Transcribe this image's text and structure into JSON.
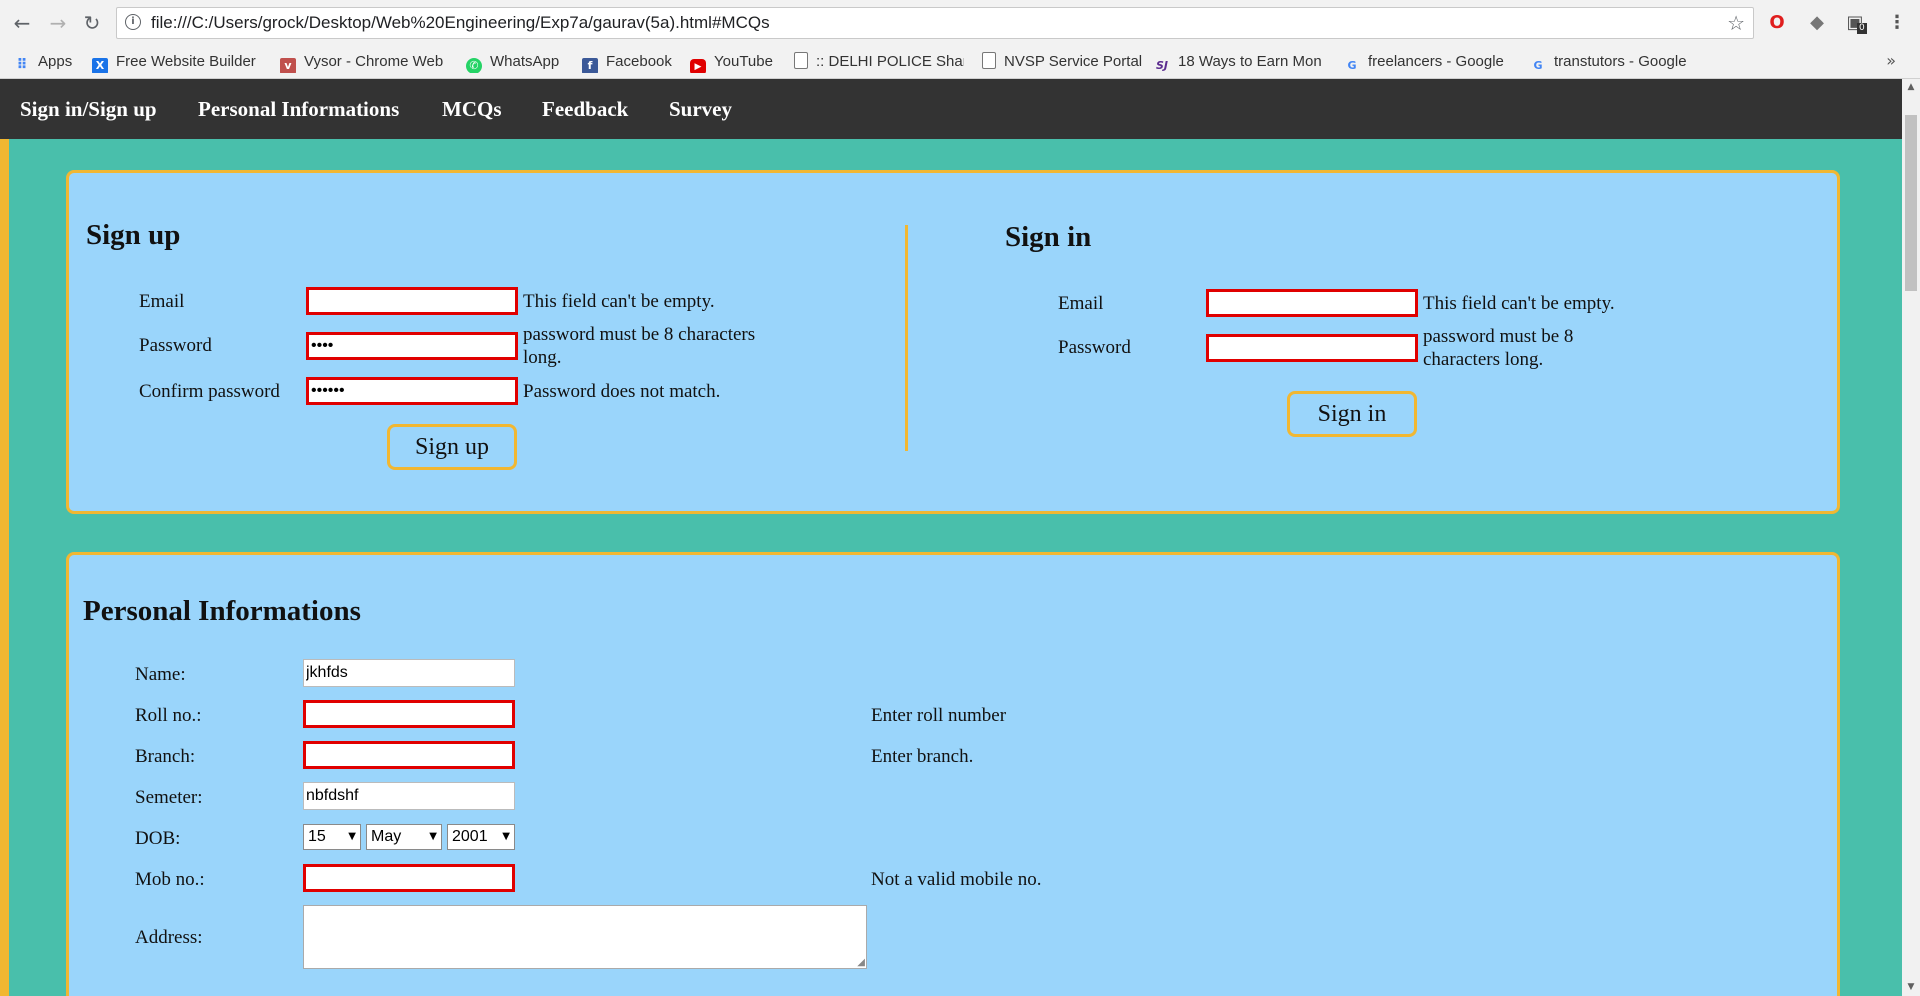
{
  "browser": {
    "url": "file:///C:/Users/grock/Desktop/Web%20Engineering/Exp7a/gaurav(5a).html#MCQs",
    "extension_badge": "0",
    "bookmarks": [
      {
        "label": "Apps",
        "icon": "apps-grid-icon"
      },
      {
        "label": "Free Website Builder",
        "icon": "wix-icon"
      },
      {
        "label": "Vysor - Chrome Web",
        "icon": "vysor-icon"
      },
      {
        "label": "WhatsApp",
        "icon": "whatsapp-icon"
      },
      {
        "label": "Facebook",
        "icon": "facebook-icon"
      },
      {
        "label": "YouTube",
        "icon": "youtube-icon"
      },
      {
        "label": ":: DELHI POLICE Shan",
        "icon": "page-icon"
      },
      {
        "label": "NVSP Service Portal",
        "icon": "page-icon"
      },
      {
        "label": "18 Ways to Earn Mon",
        "icon": "sj-icon"
      },
      {
        "label": "freelancers - Google",
        "icon": "google-icon"
      },
      {
        "label": "transtutors - Google",
        "icon": "google-icon"
      }
    ]
  },
  "nav": {
    "items": [
      "Sign in/Sign up",
      "Personal Informations",
      "MCQs",
      "Feedback",
      "Survey"
    ]
  },
  "signup": {
    "title": "Sign up",
    "email_label": "Email",
    "email_value": "",
    "email_error": "This field can't be empty.",
    "password_label": "Password",
    "password_value": "••••",
    "password_error": "password must be 8 characters long.",
    "confirm_label": "Confirm password",
    "confirm_value": "••••••",
    "confirm_error": "Password does not match.",
    "button": "Sign up"
  },
  "signin": {
    "title": "Sign in",
    "email_label": "Email",
    "email_value": "",
    "email_error": "This field can't be empty.",
    "password_label": "Password",
    "password_value": "",
    "password_error": "password must be 8 characters long.",
    "button": "Sign in"
  },
  "personal": {
    "title": "Personal Informations",
    "name_label": "Name:",
    "name_value": "jkhfds",
    "roll_label": "Roll no.:",
    "roll_value": "",
    "roll_error": "Enter roll number",
    "branch_label": "Branch:",
    "branch_value": "",
    "branch_error": "Enter branch.",
    "semester_label": "Semeter:",
    "semester_value": "nbfdshf",
    "dob_label": "DOB:",
    "dob_day": "15",
    "dob_month": "May",
    "dob_year": "2001",
    "mob_label": "Mob no.:",
    "mob_value": "",
    "mob_error": "Not a valid mobile no.",
    "address_label": "Address:",
    "address_value": ""
  },
  "colors": {
    "page_bg": "#49bfab",
    "panel_bg": "#9ad5fb",
    "accent_border": "#f1b732",
    "error_border": "#e00000",
    "nav_bg": "#333333"
  }
}
